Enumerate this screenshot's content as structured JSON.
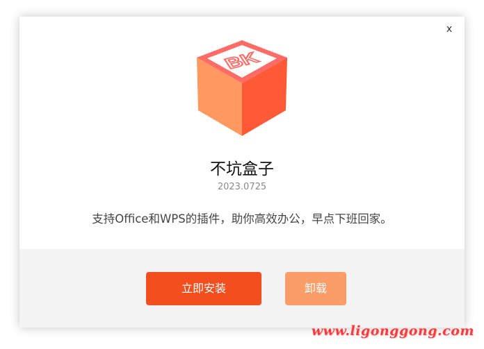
{
  "dialog": {
    "close_label": "x",
    "logo_text": "BK",
    "title": "不坑盒子",
    "version": "2023.0725",
    "description": "支持Office和WPS的插件，助你高效办公，早点下班回家。",
    "install_label": "立即安装",
    "uninstall_label": "卸载"
  },
  "watermark": {
    "text": "www.ligonggong.com"
  },
  "colors": {
    "install_button": "#f24e1e",
    "uninstall_button": "#fa9d68",
    "footer_bg": "#f4f4f4",
    "cube_top": "#ff6b66",
    "cube_left": "#ff9960",
    "cube_right": "#ff5a38"
  }
}
